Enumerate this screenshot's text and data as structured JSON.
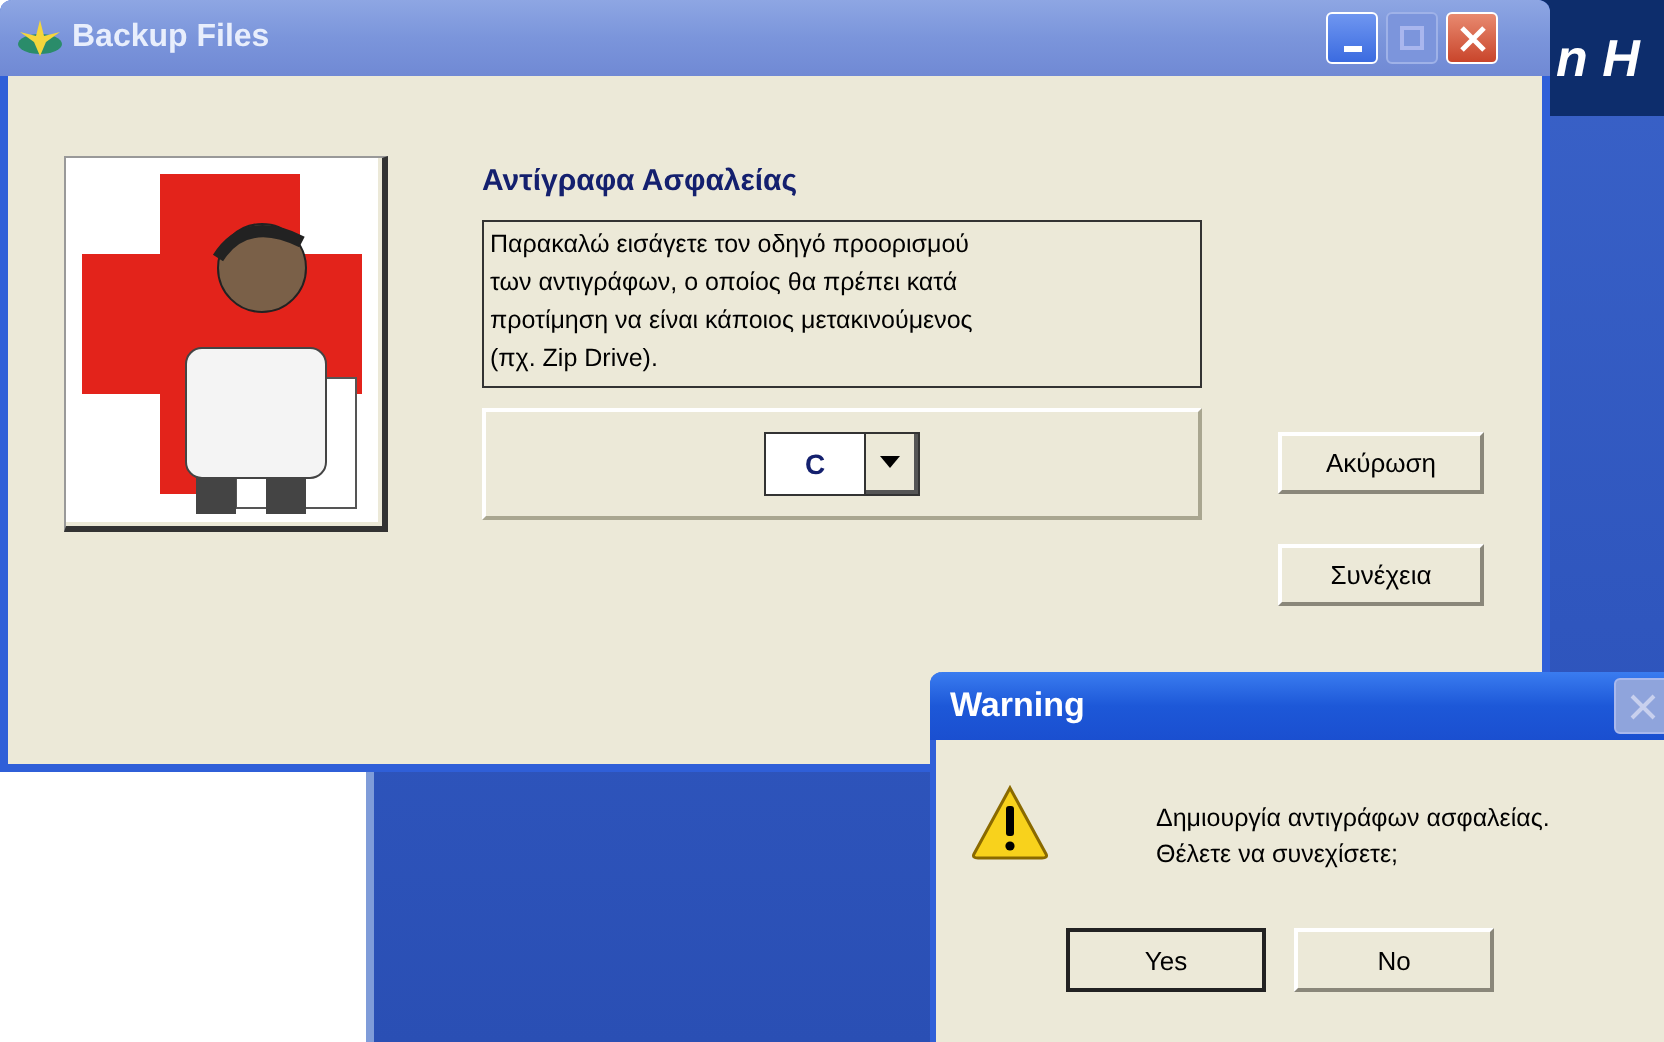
{
  "background": {
    "title_fragment": "n H"
  },
  "main_window": {
    "title": "Backup Files",
    "controls": [
      {
        "kind": "minimize",
        "disabled": false
      },
      {
        "kind": "maximize",
        "disabled": true
      },
      {
        "kind": "close",
        "disabled": false
      }
    ],
    "heading": "Αντίγραφα Ασφαλείας",
    "instructions": "Παρακαλώ εισάγετε τον οδηγό προορισμού\nτων αντιγράφων, ο οποίος θα πρέπει κατά\nπροτίμηση να είναι κάποιος μετακινούμενος\n(πχ. Zip Drive).",
    "drive": {
      "value": "C"
    },
    "buttons": [
      "Ακύρωση",
      "Συνέχεια"
    ]
  },
  "warning_dialog": {
    "title": "Warning",
    "close_disabled": true,
    "message": "Δημιουργία αντιγράφων ασφαλείας.\nΘέλετε να συνεχίσετε;",
    "buttons": [
      {
        "label": "Yes",
        "selected": true
      },
      {
        "label": "No",
        "selected": false
      }
    ]
  }
}
